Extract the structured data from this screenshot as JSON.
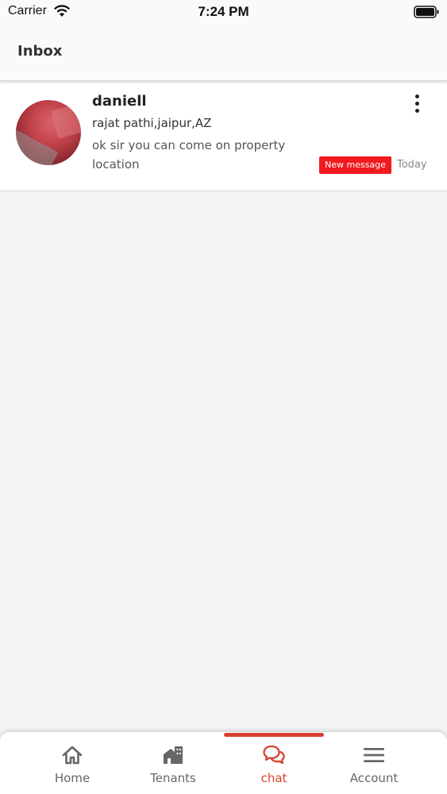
{
  "status_bar": {
    "carrier": "Carrier",
    "time": "7:24 PM"
  },
  "header": {
    "title": "Inbox"
  },
  "conversations": [
    {
      "name": "daniell",
      "location": "rajat pathi,jaipur,AZ",
      "message": "ok sir you can come on property location",
      "badge": "New message",
      "date": "Today"
    }
  ],
  "bottom_nav": {
    "items": [
      {
        "label": "Home",
        "icon": "home-icon",
        "active": false
      },
      {
        "label": "Tenants",
        "icon": "building-icon",
        "active": false
      },
      {
        "label": "chat",
        "icon": "chat-bubbles-icon",
        "active": true
      },
      {
        "label": "Account",
        "icon": "menu-icon",
        "active": false
      }
    ]
  },
  "colors": {
    "accent": "#d64130",
    "badge": "#f11a1f",
    "background": "#f3f4f6"
  }
}
